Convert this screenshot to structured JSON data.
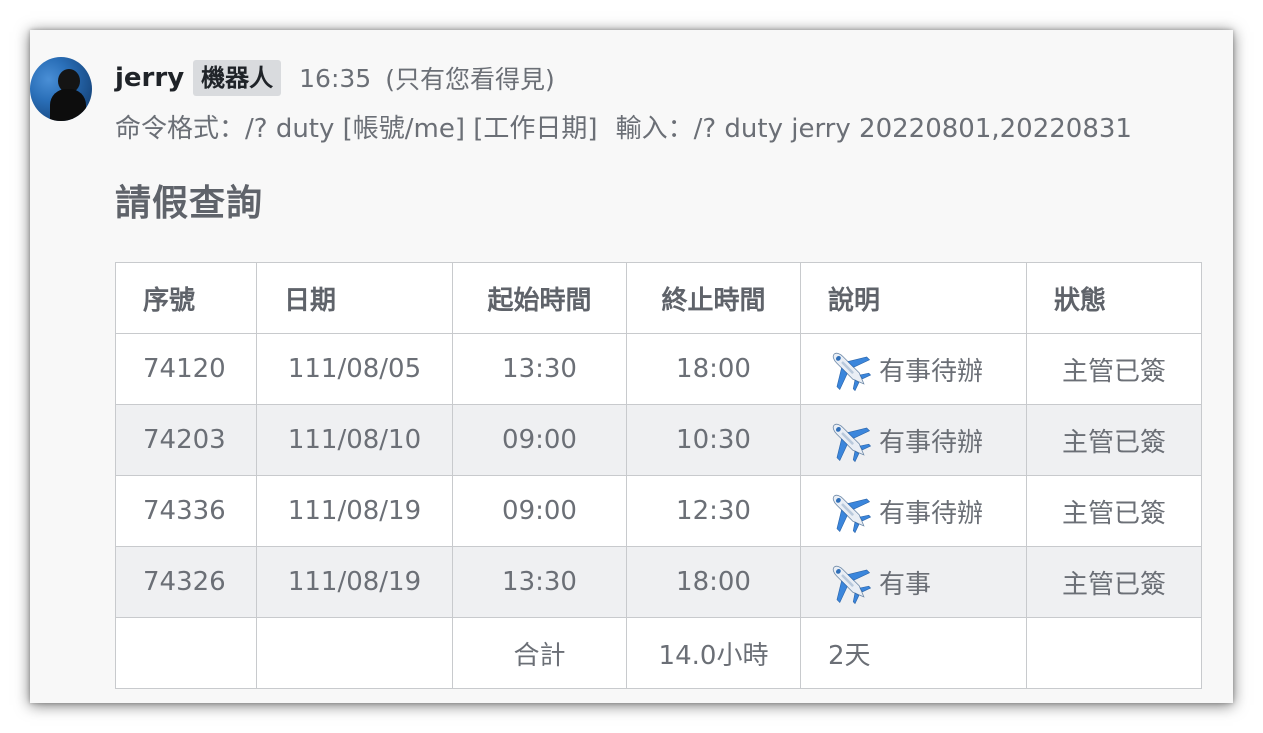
{
  "message": {
    "username": "jerry",
    "bot_badge": "機器人",
    "time": "16:35",
    "visibility": "(只有您看得見)",
    "command_format": "命令格式：/? duty [帳號/me] [工作日期]",
    "command_example": "輸入：/? duty jerry 20220801,20220831"
  },
  "title": "請假查詢",
  "table": {
    "headers": [
      "序號",
      "日期",
      "起始時間",
      "終止時間",
      "說明",
      "狀態"
    ],
    "rows": [
      {
        "id": "74120",
        "date": "111/08/05",
        "start": "13:30",
        "end": "18:00",
        "icon": "airplane-icon",
        "desc": "有事待辦",
        "status": "主管已簽"
      },
      {
        "id": "74203",
        "date": "111/08/10",
        "start": "09:00",
        "end": "10:30",
        "icon": "airplane-icon",
        "desc": "有事待辦",
        "status": "主管已簽"
      },
      {
        "id": "74336",
        "date": "111/08/19",
        "start": "09:00",
        "end": "12:30",
        "icon": "airplane-icon",
        "desc": "有事待辦",
        "status": "主管已簽"
      },
      {
        "id": "74326",
        "date": "111/08/19",
        "start": "13:30",
        "end": "18:00",
        "icon": "airplane-icon",
        "desc": "有事",
        "status": "主管已簽"
      }
    ],
    "total": {
      "label": "合計",
      "hours": "14.0小時",
      "days": "2天"
    }
  },
  "colors": {
    "text": "#6b6f76",
    "username": "#1f2328",
    "badge_bg": "#d9dbde",
    "row_alt": "#eff0f2",
    "border": "#c8cacd",
    "plane": "#2f78d0"
  }
}
